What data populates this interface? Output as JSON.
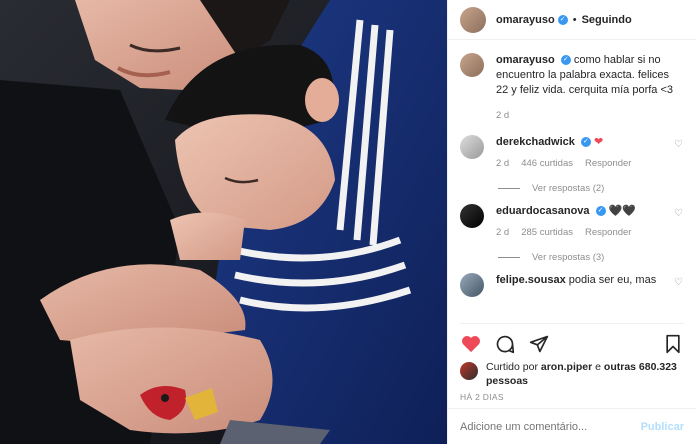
{
  "post": {
    "username": "omarayuso",
    "follow_status": "Seguindo",
    "separator": "•"
  },
  "caption": {
    "username": "omarayuso",
    "text": "como hablar si no encuentro la palabra exacta. felices 22 y feliz vida. cerquita mía porfa <3",
    "age": "2 d"
  },
  "comments": [
    {
      "username": "derekchadwick",
      "text": "",
      "emoji": "❤",
      "age": "2 d",
      "likes": "446 curtidas",
      "reply": "Responder",
      "replies": "Ver respostas (2)"
    },
    {
      "username": "eduardocasanova",
      "text": "",
      "emoji": "🖤🖤",
      "age": "2 d",
      "likes": "285 curtidas",
      "reply": "Responder",
      "replies": "Ver respostas (3)"
    },
    {
      "username": "felipe.sousax",
      "text": "podia ser eu, mas"
    }
  ],
  "liked_by": {
    "prefix": "Curtido por",
    "user": "aron.piper",
    "connector": "e",
    "others": "outras 680.323 pessoas"
  },
  "timestamp": "HÁ 2 DIAS",
  "add_comment": {
    "placeholder": "Adicione um comentário...",
    "post_label": "Publicar"
  },
  "colors": {
    "like_active": "#ed4956",
    "verified": "#3897f0"
  }
}
